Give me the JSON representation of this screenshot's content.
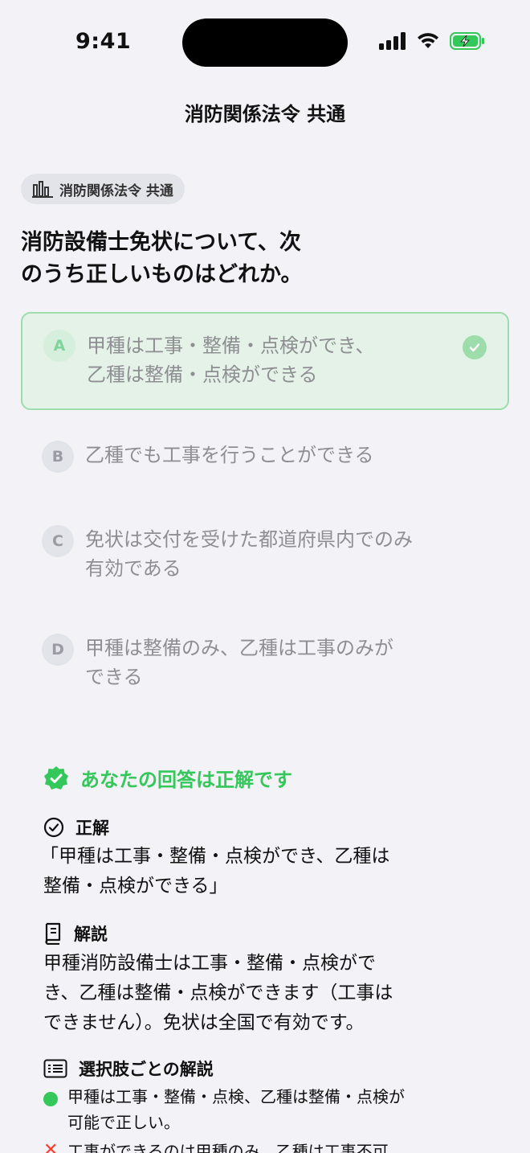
{
  "status_bar": {
    "time": "9:41"
  },
  "nav": {
    "title": "消防関係法令 共通"
  },
  "category": {
    "label": "消防関係法令 共通",
    "icon": "bar-chart-icon"
  },
  "question": {
    "text_line1": "消防設備士免状について、次",
    "text_line2": "のうち正しいものはどれか。"
  },
  "options": [
    {
      "letter": "A",
      "line1": "甲種は工事・整備・点検ができ、",
      "line2": "乙種は整備・点検ができる",
      "state": "correct"
    },
    {
      "letter": "B",
      "line1": "乙種でも工事を行うことができる",
      "line2": "",
      "state": "default"
    },
    {
      "letter": "C",
      "line1": "免状は交付を受けた都道府県内でのみ",
      "line2": "有効である",
      "state": "default"
    },
    {
      "letter": "D",
      "line1": "甲種は整備のみ、乙種は工事のみが",
      "line2": "できる",
      "state": "default"
    }
  ],
  "result": {
    "text": "あなたの回答は正解です",
    "color": "#34c759"
  },
  "answer": {
    "heading": "正解",
    "line1": "「甲種は工事・整備・点検ができ、乙種は",
    "line2": "整備・点検ができる」"
  },
  "explanation": {
    "heading": "解説",
    "line1": "甲種消防設備士は工事・整備・点検がで",
    "line2": "き、乙種は整備・点検ができます（工事は",
    "line3": "できません）。免状は全国で有効です。"
  },
  "per_choice": {
    "heading": "選択肢ごとの解説",
    "items": [
      {
        "mark": "correct",
        "line1": "甲種は工事・整備・点検、乙種は整備・点検が",
        "line2": "可能で正しい。"
      },
      {
        "mark": "wrong",
        "line1": "工事ができるのは甲種のみ。乙種は工事不可",
        "line2": ""
      }
    ]
  },
  "colors": {
    "accent_green": "#34c759",
    "background": "#f2f2f7",
    "correct_border": "#9ddcab"
  }
}
